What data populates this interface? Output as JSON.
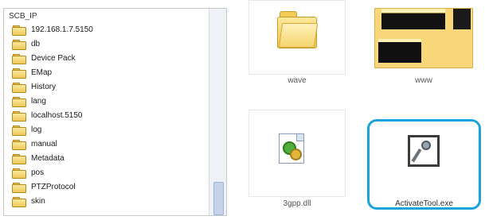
{
  "tree": {
    "root_label": "SCB_IP",
    "items": [
      {
        "label": "192.168.1.7.5150"
      },
      {
        "label": "db"
      },
      {
        "label": "Device Pack"
      },
      {
        "label": "EMap"
      },
      {
        "label": "History"
      },
      {
        "label": "lang"
      },
      {
        "label": "localhost.5150"
      },
      {
        "label": "log"
      },
      {
        "label": "manual"
      },
      {
        "label": "Metadata"
      },
      {
        "label": "pos"
      },
      {
        "label": "PTZProtocol"
      },
      {
        "label": "skin"
      }
    ]
  },
  "files": {
    "wave": {
      "label": "wave",
      "icon": "folder-icon"
    },
    "www": {
      "label": "www",
      "icon": "folder-thumbnail-icon"
    },
    "dll": {
      "label": "3gpp.dll",
      "icon": "dll-file-icon"
    },
    "exe": {
      "label": "ActivateTool.exe",
      "icon": "key-exe-icon"
    }
  },
  "colors": {
    "selection_ring": "#1aa3dc",
    "folder": "#f1c84d"
  }
}
